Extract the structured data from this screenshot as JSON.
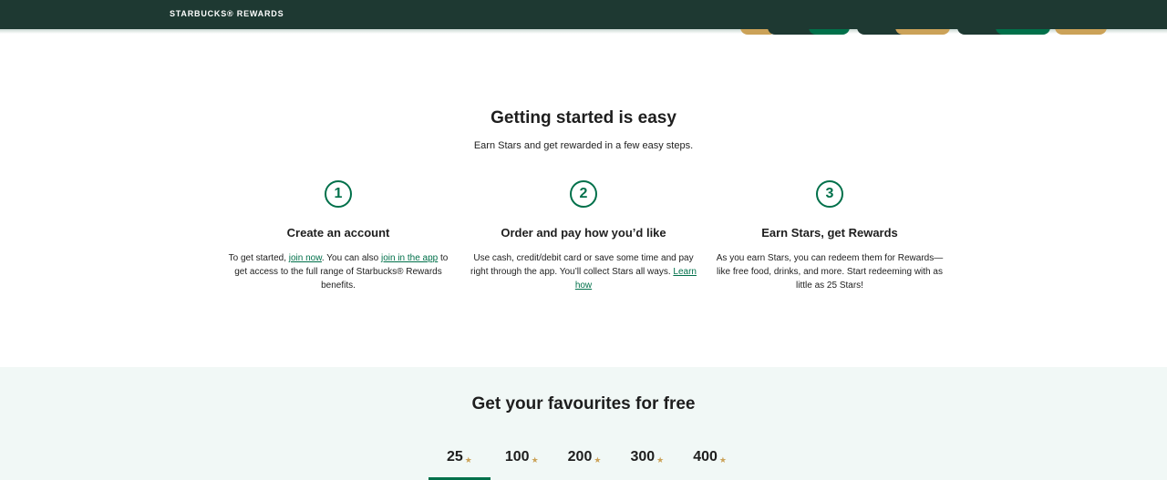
{
  "header": {
    "brand": "STARBUCKS® REWARDS"
  },
  "colors": {
    "header_bg": "#1e3932",
    "accent_green": "#00704a",
    "star_gold": "#cba258",
    "mint_bg": "#f1f8f6"
  },
  "getting_started": {
    "title": "Getting started is easy",
    "subtitle": "Earn Stars and get rewarded in a few easy steps."
  },
  "steps": [
    {
      "number": "1",
      "title": "Create an account",
      "text_a": "To get started, ",
      "link_1": "join now",
      "text_b": ". You can also ",
      "link_2": "join in the app",
      "text_c": " to get access to the full range of Starbucks® Rewards benefits."
    },
    {
      "number": "2",
      "title": "Order and pay how you’d like",
      "text_a": "Use cash, credit/debit card or save some time and pay right through the app. You’ll collect Stars all ways. ",
      "link_1": "Learn how"
    },
    {
      "number": "3",
      "title": "Earn Stars, get Rewards",
      "text_a": "As you earn Stars, you can redeem them for Rewards—like free food, drinks, and more. Start redeeming with as little as 25 Stars!"
    }
  ],
  "favourites": {
    "title": "Get your favourites for free",
    "star_glyph": "★",
    "tabs": [
      {
        "label": "25",
        "active": true
      },
      {
        "label": "100",
        "active": false
      },
      {
        "label": "200",
        "active": false
      },
      {
        "label": "300",
        "active": false
      },
      {
        "label": "400",
        "active": false
      }
    ]
  }
}
